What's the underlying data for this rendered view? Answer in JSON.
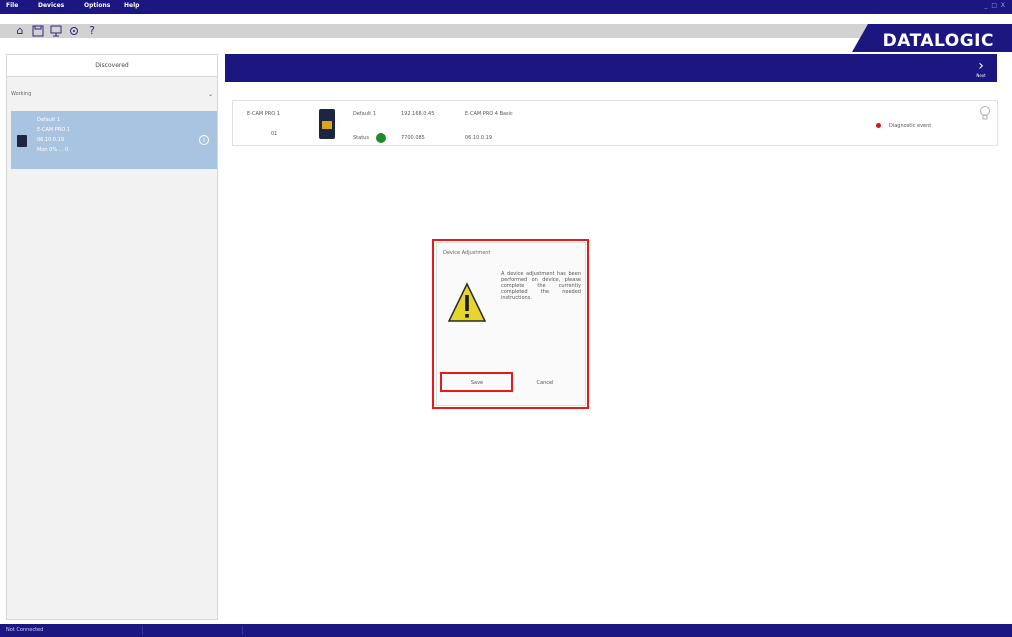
{
  "menubar": {
    "items": [
      "File",
      "Devices",
      "Options",
      "Help"
    ],
    "window_controls": "_ □ X"
  },
  "toolbar": {
    "icons": [
      "home-icon",
      "save-icon",
      "monitor-icon",
      "settings-icon",
      "help-icon"
    ],
    "help_glyph": "?",
    "home_glyph": "⌂",
    "logo_text": "DATALOGIC"
  },
  "sidebar": {
    "header": "Discovered",
    "filter_label": "Working",
    "filter_chevron": "⌄",
    "device": {
      "line1": "Default 1",
      "line2": "E-CAM PRO 1",
      "line3": "06.10.0.19",
      "line4": "Mon 0% ... 0"
    },
    "info_glyph": "i"
  },
  "main_header": {
    "next_glyph": "›",
    "next_label": "Next"
  },
  "device_panel": {
    "model": "E-CAM PRO 1",
    "index": "01",
    "name": "Default 1",
    "status_label": "Status",
    "ip_label": "192.168.0.45",
    "mac": "7700.085",
    "desc": "E-CAM PRO 4 Basic",
    "version": "06.10.0.19",
    "alert_label": "Diagnostic event"
  },
  "dialog": {
    "title": "Device Adjustment",
    "message": "A device adjustment has been performed on device, please complete the currently completed the needed instructions.",
    "save_label": "Save",
    "cancel_label": "Cancel"
  },
  "status": {
    "text": "Not Connected"
  },
  "colors": {
    "brand": "#1c1680",
    "highlight": "#e51b1b",
    "selected_card": "#a9c4e0",
    "status_ok": "#1f8a2e",
    "alert": "#d01818"
  }
}
